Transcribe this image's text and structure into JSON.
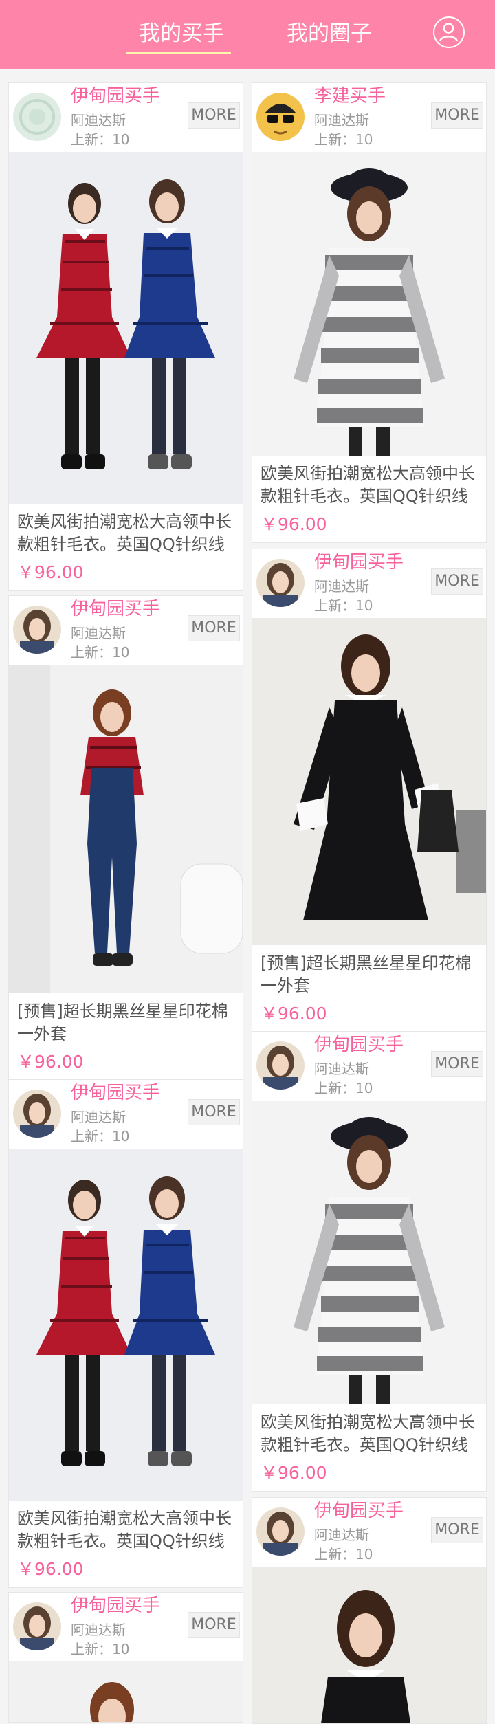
{
  "header": {
    "tab_active": "我的买手",
    "tab_other": "我的圈子",
    "profile_icon": "user-icon",
    "colors": {
      "bar": "#fe85a9",
      "underline": "#fff3b0"
    }
  },
  "cards": [
    {
      "shop": "伊甸园买手",
      "brand": "阿迪达斯",
      "new": "上新：10",
      "more": "MORE",
      "desc": "欧美风街拍潮宽松大高领中长款粗针毛衣。英国QQ针织线",
      "price": "￥96.00",
      "photo": "plaid-dresses-duo"
    },
    {
      "shop": "李建买手",
      "brand": "阿迪达斯",
      "new": "上新：10",
      "more": "MORE",
      "desc": "欧美风街拍潮宽松大高领中长款粗针毛衣。英国QQ针织线",
      "price": "￥96.00",
      "photo": "striped-sweater-dress"
    },
    {
      "shop": "伊甸园买手",
      "brand": "阿迪达斯",
      "new": "上新：10",
      "more": "MORE",
      "desc": "[预售]超长期黑丝星星印花棉一外套",
      "price": "￥96.00",
      "photo": "denim-overalls"
    },
    {
      "shop": "伊甸园买手",
      "brand": "阿迪达斯",
      "new": "上新：10",
      "more": "MORE",
      "desc": "[预售]超长期黑丝星星印花棉一外套",
      "price": "￥96.00",
      "photo": "black-dress-white-collar"
    },
    {
      "shop": "伊甸园买手",
      "brand": "阿迪达斯",
      "new": "上新：10",
      "more": "MORE",
      "desc": "欧美风街拍潮宽松大高领中长款粗针毛衣。英国QQ针织线",
      "price": "￥96.00",
      "photo": "plaid-dresses-duo"
    },
    {
      "shop": "伊甸园买手",
      "brand": "阿迪达斯",
      "new": "上新：10",
      "more": "MORE",
      "desc": "欧美风街拍潮宽松大高领中长款粗针毛衣。英国QQ针织线",
      "price": "￥96.00",
      "photo": "striped-sweater-dress"
    },
    {
      "shop": "伊甸园买手",
      "brand": "阿迪达斯",
      "new": "上新：10",
      "more": "MORE",
      "photo": "plaid-dresses-duo"
    },
    {
      "shop": "伊甸园买手",
      "brand": "阿迪达斯",
      "new": "上新：10",
      "more": "MORE",
      "photo": "black-dress-white-collar"
    }
  ]
}
